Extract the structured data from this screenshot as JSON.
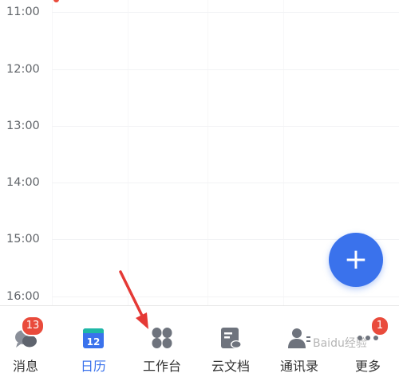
{
  "timeline": {
    "hours": [
      "11:00",
      "12:00",
      "13:00",
      "14:00",
      "15:00",
      "16:00"
    ]
  },
  "fab": {
    "icon": "plus-icon",
    "label": "+"
  },
  "bottom_nav": {
    "items": [
      {
        "label": "消息",
        "icon": "chat-bubbles-icon",
        "badge": "13"
      },
      {
        "label": "日历",
        "icon": "calendar-icon",
        "date": "12",
        "active": true
      },
      {
        "label": "工作台",
        "icon": "workbench-grid-icon"
      },
      {
        "label": "云文档",
        "icon": "cloud-doc-icon"
      },
      {
        "label": "通讯录",
        "icon": "contacts-icon"
      },
      {
        "label": "更多",
        "icon": "more-dots-icon",
        "badge": "1"
      }
    ]
  },
  "colors": {
    "accent": "#3a72ec",
    "badge": "#e94b3c",
    "now_line": "#e94b3c",
    "arrow": "#e53935"
  },
  "watermark": "Baidu经验"
}
